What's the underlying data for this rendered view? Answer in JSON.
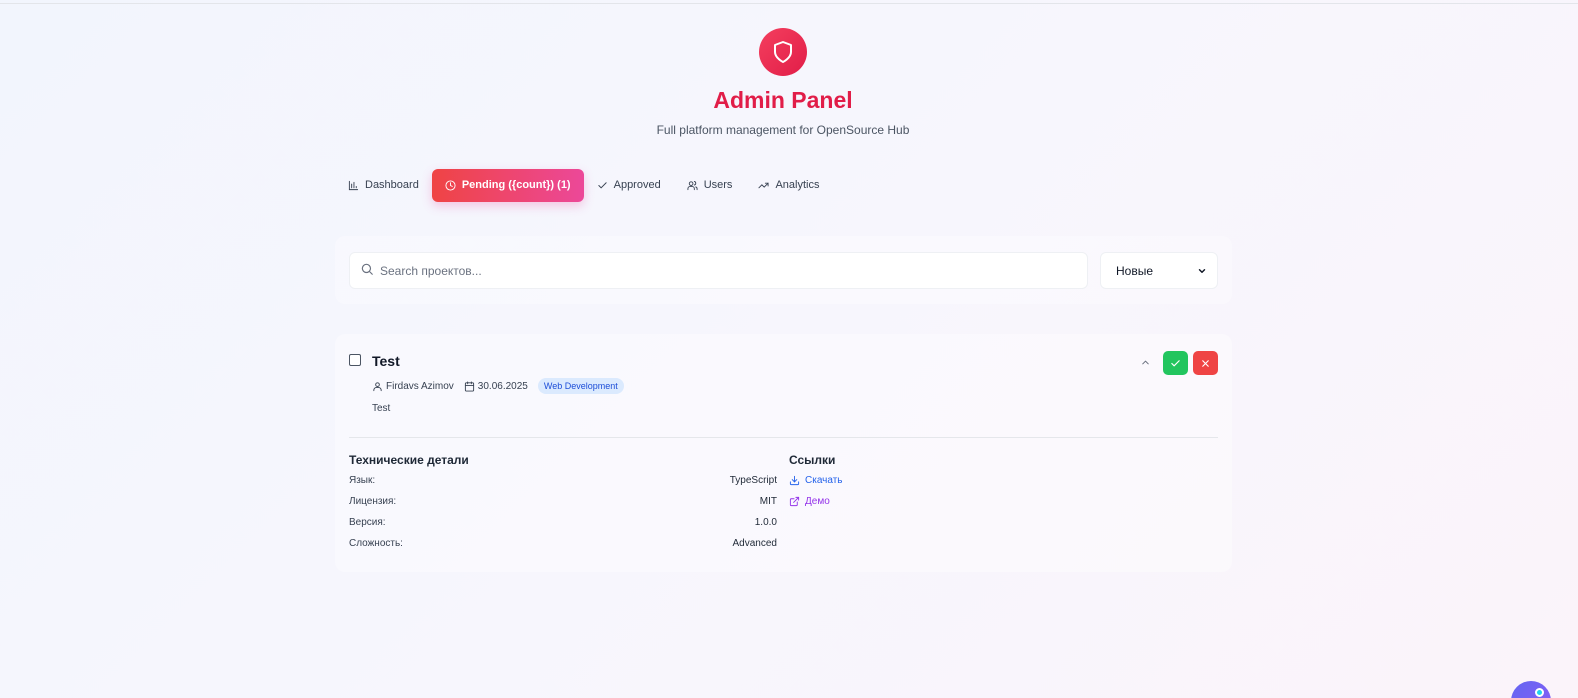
{
  "header": {
    "title": "Admin Panel",
    "subtitle": "Full platform management for OpenSource Hub",
    "logo_icon": "shield-icon",
    "accent_color": "#e11d48"
  },
  "tabs": [
    {
      "label": "Dashboard",
      "icon": "bar-chart-icon",
      "active": false
    },
    {
      "label": "Pending ({count}) (1)",
      "icon": "clock-icon",
      "active": true
    },
    {
      "label": "Approved",
      "icon": "check-icon",
      "active": false
    },
    {
      "label": "Users",
      "icon": "users-icon",
      "active": false
    },
    {
      "label": "Analytics",
      "icon": "trending-up-icon",
      "active": false
    }
  ],
  "filters": {
    "search_placeholder": "Search проектов...",
    "search_value": "",
    "sort_selected": "Новые"
  },
  "project": {
    "title": "Test",
    "author": "Firdavs Azimov",
    "date": "30.06.2025",
    "category": "Web Development",
    "description": "Test",
    "tech": {
      "title": "Технические детали",
      "rows": [
        {
          "label": "Язык:",
          "value": "TypeScript"
        },
        {
          "label": "Лицензия:",
          "value": "MIT"
        },
        {
          "label": "Версия:",
          "value": "1.0.0"
        },
        {
          "label": "Сложность:",
          "value": "Advanced"
        }
      ]
    },
    "links": {
      "title": "Ссылки",
      "download": "Скачать",
      "demo": "Демо"
    }
  },
  "colors": {
    "approve": "#22c55e",
    "reject": "#ef4444",
    "badge_bg": "#dbeafe",
    "badge_text": "#1d4ed8"
  }
}
